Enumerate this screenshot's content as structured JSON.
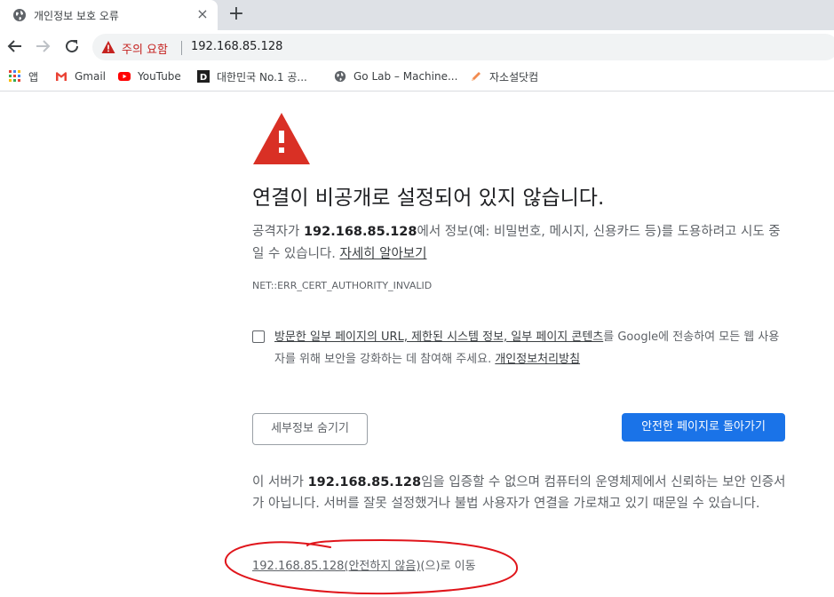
{
  "tab": {
    "title": "개인정보 보호 오류",
    "close": "×",
    "new_tab": "+"
  },
  "omnibox": {
    "security_label": "주의 요함",
    "url": "192.168.85.128"
  },
  "bookmarks": [
    {
      "label": "앱",
      "icon": "apps-grid-icon"
    },
    {
      "label": "Gmail",
      "icon": "gmail-icon"
    },
    {
      "label": "YouTube",
      "icon": "youtube-icon"
    },
    {
      "label": "대한민국 No.1 공...",
      "icon": "d-logo-icon"
    },
    {
      "label": "Go Lab – Machine...",
      "icon": "globe-icon"
    },
    {
      "label": "자소설닷컴",
      "icon": "pen-icon"
    }
  ],
  "main": {
    "heading": "연결이 비공개로 설정되어 있지 않습니다.",
    "desc_before": "공격자가 ",
    "desc_host": "192.168.85.128",
    "desc_after": "에서 정보(예: 비밀번호, 메시지, 신용카드 등)를 도용하려고 시도 중일 수 있습니다. ",
    "learn_more": "자세히 알아보기",
    "error_code": "NET::ERR_CERT_AUTHORITY_INVALID",
    "checkbox_link": "방문한 일부 페이지의 URL, 제한된 시스템 정보, 일부 페이지 콘텐츠",
    "checkbox_text": "를 Google에 전송하여 모든 웹 사용자를 위해 보안을 강화하는 데 참여해 주세요. ",
    "privacy_link": "개인정보처리방침",
    "hide_details_button": "세부정보 숨기기",
    "back_to_safety_button": "안전한 페이지로 돌아가기",
    "detail_before": "이 서버가 ",
    "detail_host": "192.168.85.128",
    "detail_after": "임을 입증할 수 없으며 컴퓨터의 운영체제에서 신뢰하는 보안 인증서가 아닙니다. 서버를 잘못 설정했거나 불법 사용자가 연결을 가로채고 있기 때문일 수 있습니다.",
    "proceed_link": "192.168.85.128(안전하지 않음)",
    "proceed_suffix": "(으)로 이동"
  },
  "colors": {
    "danger": "#d93025",
    "accent": "#1a73e8",
    "annotation": "#e0151b"
  }
}
